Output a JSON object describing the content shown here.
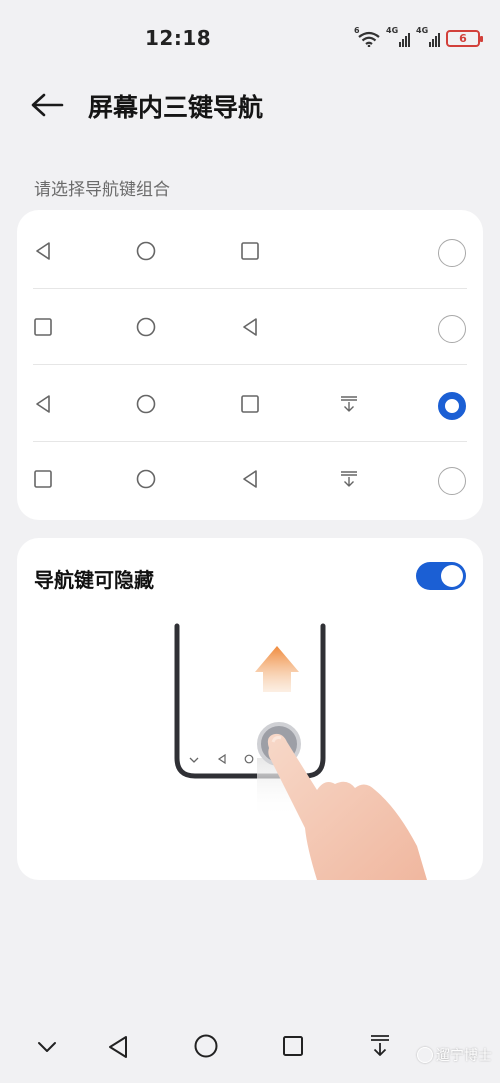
{
  "status_bar": {
    "time": "12:18",
    "wifi_label": "6",
    "signal_1_label": "4G",
    "signal_2_label": "4G",
    "battery_level": "6",
    "battery_color": "#d2403a"
  },
  "header": {
    "back_icon": "back-arrow-icon",
    "title": "屏幕内三键导航"
  },
  "section_label": "请选择导航键组合",
  "combinations": [
    {
      "icons": [
        "back-triangle",
        "home-circle",
        "recents-square"
      ],
      "has_hide_key": false,
      "selected": false
    },
    {
      "icons": [
        "recents-square",
        "home-circle",
        "back-triangle"
      ],
      "has_hide_key": false,
      "selected": false
    },
    {
      "icons": [
        "back-triangle",
        "home-circle",
        "recents-square"
      ],
      "has_hide_key": true,
      "selected": true
    },
    {
      "icons": [
        "recents-square",
        "home-circle",
        "back-triangle"
      ],
      "has_hide_key": true,
      "selected": false
    }
  ],
  "hide_setting": {
    "label": "导航键可隐藏",
    "enabled": true
  },
  "bottom_nav": [
    "chevron-down-icon",
    "back-triangle-icon",
    "home-circle-icon",
    "recents-square-icon",
    "hide-key-icon"
  ],
  "watermark": "遛宁博士",
  "accent_color": "#1b5fd4"
}
